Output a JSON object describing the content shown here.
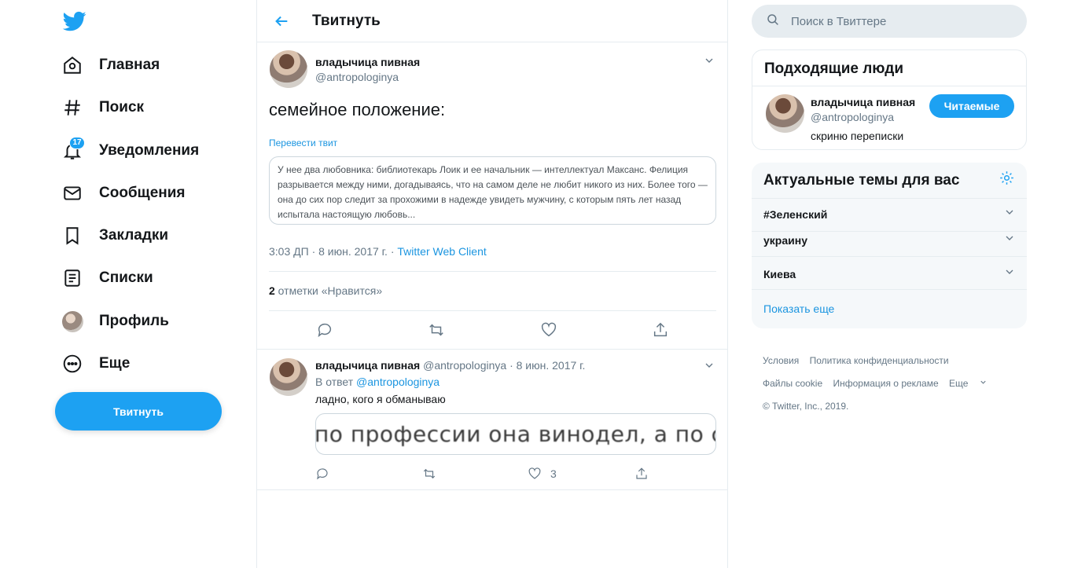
{
  "colors": {
    "accent": "#1da1f2",
    "link": "#1b95e0",
    "muted": "#657786",
    "border": "#e6ecf0"
  },
  "nav": {
    "logo": "twitter-bird-icon",
    "items": [
      {
        "label": "Главная",
        "icon": "home-icon"
      },
      {
        "label": "Поиск",
        "icon": "hashtag-icon"
      },
      {
        "label": "Уведомления",
        "icon": "bell-icon",
        "badge": "17"
      },
      {
        "label": "Сообщения",
        "icon": "envelope-icon"
      },
      {
        "label": "Закладки",
        "icon": "bookmark-icon"
      },
      {
        "label": "Списки",
        "icon": "list-icon"
      },
      {
        "label": "Профиль",
        "icon": "avatar"
      },
      {
        "label": "Еще",
        "icon": "more-circle-icon"
      }
    ],
    "tweet_button": "Твитнуть"
  },
  "header": {
    "title": "Твитнуть"
  },
  "tweet": {
    "author_name": "владычица пивная",
    "author_handle": "@antropologinya",
    "text": "семейное положение:",
    "translate_label": "Перевести твит",
    "translation": "У нее два любовника: библиотекарь Лоик и ее начальник — интеллектуал Максанс. Фелиция разрывается между ними, догадываясь, что на самом деле не любит никого из них. Более того — она до сих пор следит за прохожими в надежде увидеть мужчину, с которым пять лет назад испытала настоящую любовь...",
    "time": "3:03 ДП · 8 июн. 2017 г. · ",
    "client": "Twitter Web Client",
    "likes_count": "2",
    "likes_label": " отметки «Нравится»"
  },
  "reply": {
    "author_name": "владычица пивная",
    "author_handle": "@antropologinya",
    "date": "· 8 июн. 2017 г.",
    "reply_to_label": "В ответ ",
    "reply_to_handle": "@antropologinya",
    "text": "ладно, кого я обманываю",
    "media_text": "по профессии она винодел, а по семейному положению",
    "likes": "3"
  },
  "search": {
    "placeholder": "Поиск в Твиттере"
  },
  "people": {
    "title": "Подходящие люди",
    "name": "владычица пивная",
    "handle": "@antropologinya",
    "bio": "скриню переписки",
    "follow_label": "Читаемые"
  },
  "trends": {
    "title": "Актуальные темы для вас",
    "items": [
      "#Зеленский",
      "украину",
      "Киева"
    ],
    "show_more": "Показать еще"
  },
  "footer": {
    "terms": "Условия",
    "privacy": "Политика конфиденциальности",
    "cookies": "Файлы cookie",
    "ads": "Информация о рекламе",
    "more": "Еще",
    "copyright": "© Twitter, Inc., 2019."
  }
}
